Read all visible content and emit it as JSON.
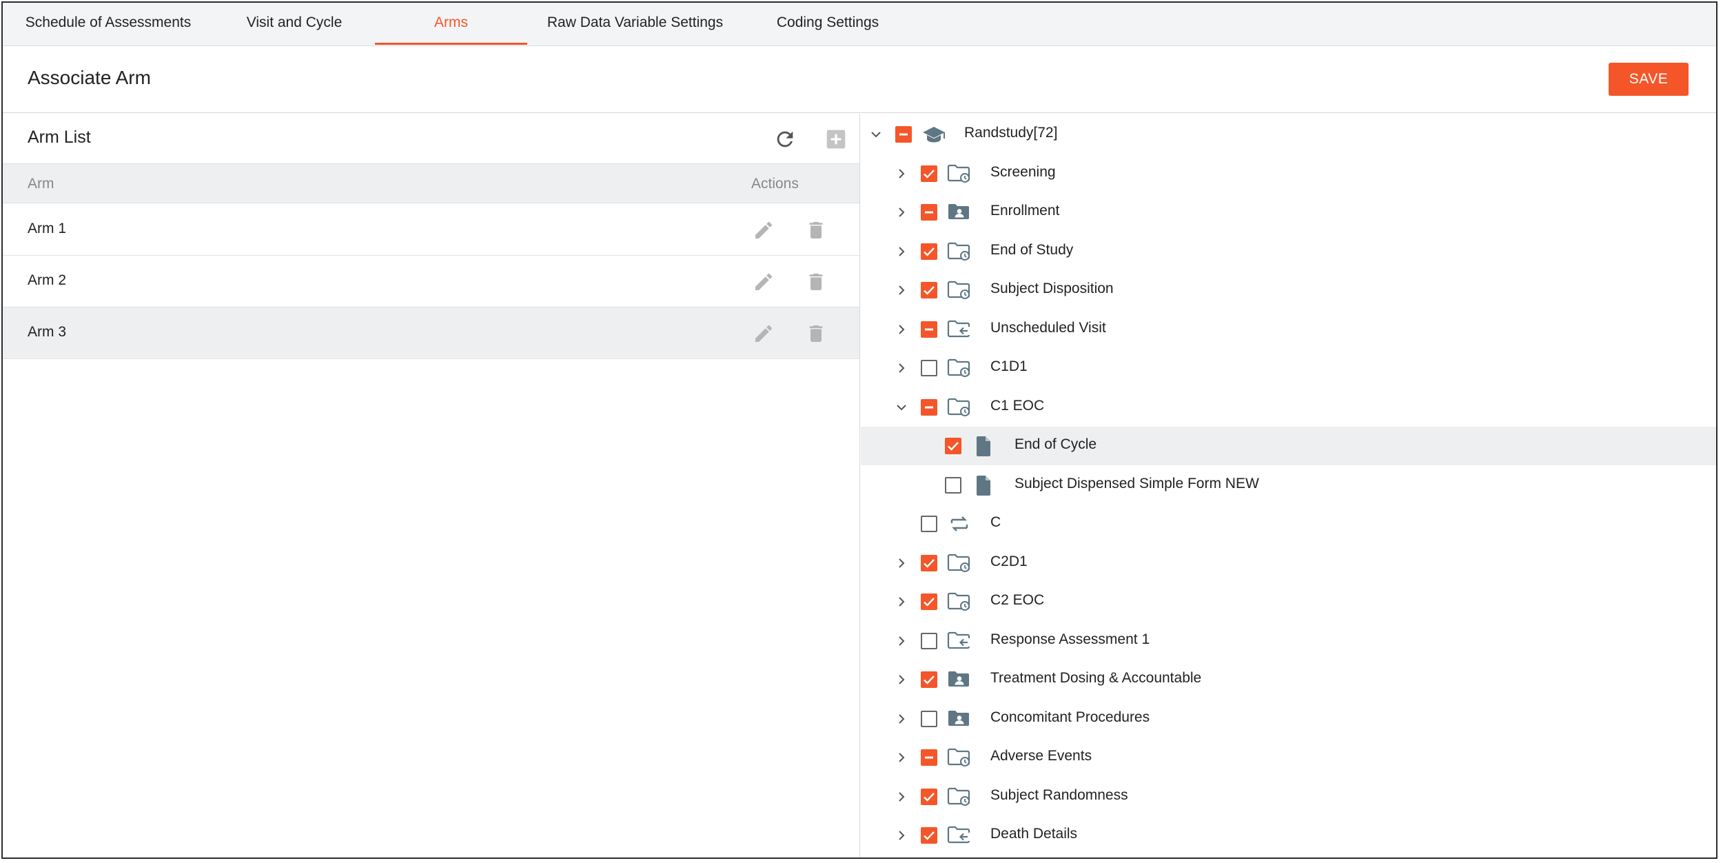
{
  "tabs": [
    {
      "label": "Schedule of Assessments",
      "active": false
    },
    {
      "label": "Visit and Cycle",
      "active": false
    },
    {
      "label": "Arms",
      "active": true
    },
    {
      "label": "Raw Data Variable Settings",
      "active": false
    },
    {
      "label": "Coding Settings",
      "active": false
    }
  ],
  "header": {
    "title": "Associate Arm",
    "save_label": "SAVE"
  },
  "arm_list": {
    "title": "Arm List",
    "columns": {
      "arm": "Arm",
      "actions": "Actions"
    },
    "rows": [
      {
        "name": "Arm 1",
        "selected": false
      },
      {
        "name": "Arm 2",
        "selected": false
      },
      {
        "name": "Arm 3",
        "selected": true
      }
    ]
  },
  "tree": {
    "rows": [
      {
        "label": "Randstudy[72]",
        "level": 0,
        "chevron": "down",
        "state": "indeterminate",
        "icon": "study-cap-icon",
        "highlighted": false
      },
      {
        "label": "Screening",
        "level": 1,
        "chevron": "right",
        "state": "checked",
        "icon": "folder-clock-icon",
        "highlighted": false
      },
      {
        "label": "Enrollment",
        "level": 1,
        "chevron": "right",
        "state": "indeterminate",
        "icon": "folder-person-icon",
        "highlighted": false
      },
      {
        "label": "End of Study",
        "level": 1,
        "chevron": "right",
        "state": "checked",
        "icon": "folder-clock-icon",
        "highlighted": false
      },
      {
        "label": "Subject Disposition",
        "level": 1,
        "chevron": "right",
        "state": "checked",
        "icon": "folder-clock-icon",
        "highlighted": false
      },
      {
        "label": "Unscheduled Visit",
        "level": 1,
        "chevron": "right",
        "state": "indeterminate",
        "icon": "folder-arrow-icon",
        "highlighted": false
      },
      {
        "label": "C1D1",
        "level": 1,
        "chevron": "right",
        "state": "unchecked",
        "icon": "folder-clock-icon",
        "highlighted": false
      },
      {
        "label": "C1 EOC",
        "level": 1,
        "chevron": "down",
        "state": "indeterminate",
        "icon": "folder-clock-icon",
        "highlighted": false
      },
      {
        "label": "End of Cycle",
        "level": 2,
        "chevron": "none",
        "state": "checked",
        "icon": "document-icon",
        "highlighted": true
      },
      {
        "label": "Subject Dispensed Simple Form NEW",
        "level": 2,
        "chevron": "none",
        "state": "unchecked",
        "icon": "document-icon",
        "highlighted": false
      },
      {
        "label": "C",
        "level": 1,
        "chevron": "none",
        "state": "unchecked",
        "icon": "repeat-icon",
        "highlighted": false
      },
      {
        "label": "C2D1",
        "level": 1,
        "chevron": "right",
        "state": "checked",
        "icon": "folder-clock-icon",
        "highlighted": false
      },
      {
        "label": "C2 EOC",
        "level": 1,
        "chevron": "right",
        "state": "checked",
        "icon": "folder-clock-icon",
        "highlighted": false
      },
      {
        "label": "Response Assessment 1",
        "level": 1,
        "chevron": "right",
        "state": "unchecked",
        "icon": "folder-arrow-icon",
        "highlighted": false
      },
      {
        "label": "Treatment Dosing & Accountable",
        "level": 1,
        "chevron": "right",
        "state": "checked",
        "icon": "folder-person-icon",
        "highlighted": false
      },
      {
        "label": "Concomitant Procedures",
        "level": 1,
        "chevron": "right",
        "state": "unchecked",
        "icon": "folder-person-icon",
        "highlighted": false
      },
      {
        "label": "Adverse Events",
        "level": 1,
        "chevron": "right",
        "state": "indeterminate",
        "icon": "folder-clock-icon",
        "highlighted": false
      },
      {
        "label": "Subject Randomness",
        "level": 1,
        "chevron": "right",
        "state": "checked",
        "icon": "folder-clock-icon",
        "highlighted": false
      },
      {
        "label": "Death Details",
        "level": 1,
        "chevron": "right",
        "state": "checked",
        "icon": "folder-arrow-icon",
        "highlighted": false
      }
    ]
  },
  "colors": {
    "accent": "#f4562a",
    "icon": "#5f7684",
    "muted_icon": "#b5b5b5"
  }
}
